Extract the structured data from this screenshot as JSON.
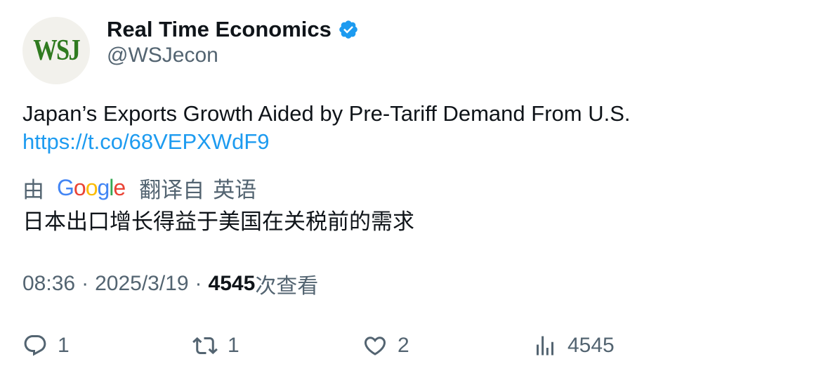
{
  "author": {
    "avatar_text": "WSJ",
    "display_name": "Real Time Economics",
    "verified_icon": "verified-badge-icon",
    "handle": "@WSJecon"
  },
  "tweet": {
    "text": "Japan’s Exports Growth Aided by Pre-Tariff Demand From U.S.",
    "link": "https://t.co/68VEPXWdF9"
  },
  "translation": {
    "by_label": "由",
    "provider_logo_letters": [
      "G",
      "o",
      "o",
      "g",
      "l",
      "e"
    ],
    "translated_from_label": "翻译自",
    "source_language": "英语",
    "translated_text": "日本出口增长得益于美国在关税前的需求"
  },
  "meta": {
    "time": "08:36",
    "separator": "·",
    "date": "2025/3/19",
    "views_count": "4545",
    "views_label": "次查看"
  },
  "actions": {
    "reply": {
      "icon": "reply-icon",
      "count": "1"
    },
    "retweet": {
      "icon": "retweet-icon",
      "count": "1"
    },
    "like": {
      "icon": "heart-icon",
      "count": "2"
    },
    "views": {
      "icon": "analytics-icon",
      "count": "4545"
    }
  },
  "colors": {
    "text_primary": "#0f1419",
    "text_secondary": "#536471",
    "link": "#1d9bf0",
    "verified": "#1d9bf0",
    "wsj_green": "#2f7a1f"
  }
}
